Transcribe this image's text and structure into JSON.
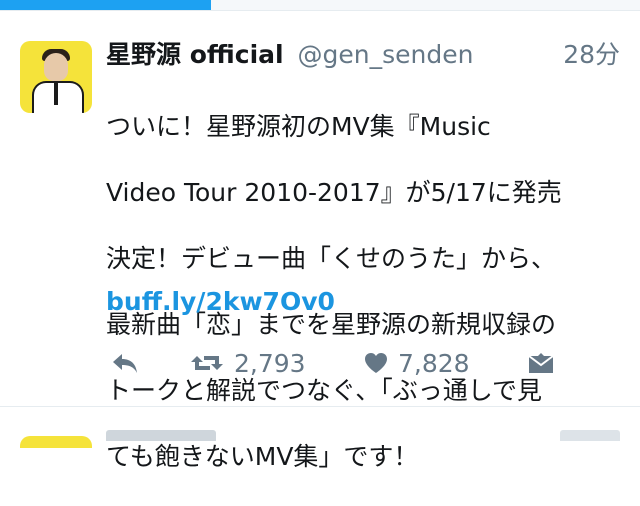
{
  "progress": {
    "fraction": 0.33,
    "color": "#1da1f2"
  },
  "tweet": {
    "author_name": "星野源 official",
    "handle": "@gen_senden",
    "time": "28分",
    "body_lines": [
      "ついに！星野源初のMV集『Music",
      "Video Tour 2010-2017』が5/17に発売",
      "決定！デビュー曲「くせのうた」から、",
      "最新曲「恋」までを星野源の新規収録の",
      "トークと解説でつなぐ、「ぶっ通しで見",
      "ても飽きないMV集」です！"
    ],
    "link": "buff.ly/2kw7Ov0",
    "actions": {
      "reply_icon": "reply-icon",
      "retweet_icon": "retweet-icon",
      "retweet_count": "2,793",
      "like_icon": "heart-icon",
      "like_count": "7,828",
      "dm_icon": "envelope-icon"
    }
  },
  "colors": {
    "text": "#14171a",
    "secondary": "#657786",
    "link": "#1b95e0",
    "avatar_bg": "#f5e33a"
  }
}
